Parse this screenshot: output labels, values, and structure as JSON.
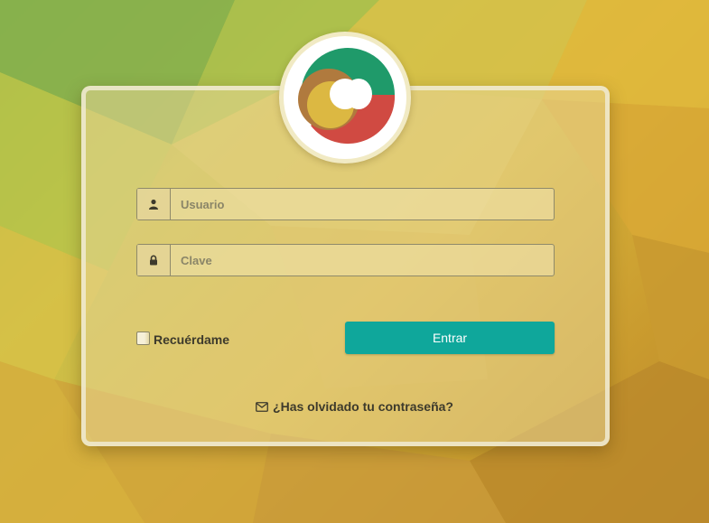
{
  "login": {
    "username_placeholder": "Usuario",
    "password_placeholder": "Clave",
    "remember_label": "Recuérdame",
    "submit_label": "Entrar",
    "forgot_label": "¿Has olvidado tu contraseña?"
  },
  "icons": {
    "username": "user-icon",
    "password": "lock-icon",
    "forgot": "envelope-icon",
    "logo": "logo-icon"
  },
  "colors": {
    "accent": "#0fa79b",
    "logo_green": "#1f9a6a",
    "logo_red": "#d04a42",
    "logo_yellow": "#dcb842",
    "logo_brown": "#b07a3e"
  }
}
